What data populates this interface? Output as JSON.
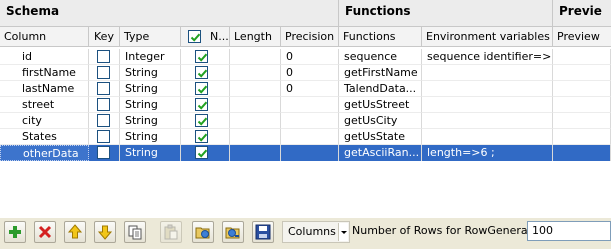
{
  "sections": {
    "schema": "Schema",
    "functions": "Functions",
    "preview": "Previe"
  },
  "columns": {
    "column": "Column",
    "key": "Key",
    "type": "Type",
    "nullable": "N...",
    "length": "Length",
    "precision": "Precision",
    "functions": "Functions",
    "env": "Environment variables",
    "preview": "Preview"
  },
  "rows": [
    {
      "name": "id",
      "key": false,
      "type": "Integer",
      "nullable": true,
      "length": "",
      "precision": "0",
      "function": "sequence",
      "env": "sequence identifier=>...",
      "selected": false
    },
    {
      "name": "firstName",
      "key": false,
      "type": "String",
      "nullable": true,
      "length": "",
      "precision": "0",
      "function": "getFirstName",
      "env": "",
      "selected": false
    },
    {
      "name": "lastName",
      "key": false,
      "type": "String",
      "nullable": true,
      "length": "",
      "precision": "0",
      "function": "TalendData...",
      "env": "",
      "selected": false
    },
    {
      "name": "street",
      "key": false,
      "type": "String",
      "nullable": true,
      "length": "",
      "precision": "",
      "function": "getUsStreet",
      "env": "",
      "selected": false
    },
    {
      "name": "city",
      "key": false,
      "type": "String",
      "nullable": true,
      "length": "",
      "precision": "",
      "function": "getUsCity",
      "env": "",
      "selected": false
    },
    {
      "name": "States",
      "key": false,
      "type": "String",
      "nullable": true,
      "length": "",
      "precision": "",
      "function": "getUsState",
      "env": "",
      "selected": false
    },
    {
      "name": "otherData",
      "key": false,
      "type": "String",
      "nullable": true,
      "length": "",
      "precision": "",
      "function": "getAsciiRan...",
      "env": "length=>6 ;",
      "selected": true
    }
  ],
  "toolbar": {
    "buttons": [
      {
        "name": "add-button",
        "icon": "plus-icon"
      },
      {
        "name": "remove-button",
        "icon": "remove-icon"
      },
      {
        "name": "move-up-button",
        "icon": "arrow-up-icon"
      },
      {
        "name": "move-down-button",
        "icon": "arrow-down-icon"
      },
      {
        "name": "copy-button",
        "icon": "copy-icon"
      },
      {
        "name": "paste-button",
        "icon": "paste-icon"
      },
      {
        "name": "import-button",
        "icon": "import-icon"
      },
      {
        "name": "export-button",
        "icon": "export-icon"
      },
      {
        "name": "save-button",
        "icon": "save-icon"
      }
    ],
    "columns_label": "Columns",
    "rows_label": "Number of Rows for RowGenerator",
    "rows_value": "100"
  },
  "colors": {
    "selection": "#316ac5",
    "check": "#21a121",
    "add": "#2c9b2c",
    "remove": "#d42020",
    "arrow": "#e6b800"
  }
}
